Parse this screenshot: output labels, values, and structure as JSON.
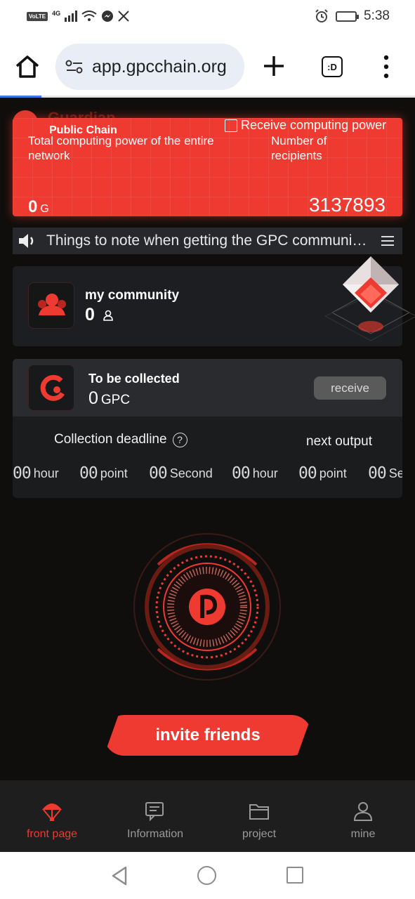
{
  "status_bar": {
    "time": "5:38",
    "volte": "VoLTE",
    "network": "4G"
  },
  "browser": {
    "url": "app.gpcchain.org",
    "tabs_label": ":D"
  },
  "page": {
    "logo_peek_text": "Guardian",
    "power_card": {
      "public_chain": "Public Chain",
      "receive_link": "Receive computing power",
      "total_label": "Total computing power of the entire network",
      "total_value": "0",
      "total_unit": "G",
      "recipients_label": "Number of recipients",
      "recipients_value": "3137893"
    },
    "notice": {
      "text": "Things to note when getting the GPC community computing power"
    },
    "community": {
      "title": "my community",
      "count": "0"
    },
    "collect": {
      "title": "To be collected",
      "value": "0",
      "unit": "GPC",
      "receive_label": "receive",
      "deadline_label": "Collection deadline",
      "next_label": "next output",
      "timers": [
        {
          "digits": "00",
          "unit": "hour"
        },
        {
          "digits": "00",
          "unit": "point"
        },
        {
          "digits": "00",
          "unit": "Second"
        },
        {
          "digits": "00",
          "unit": "hour"
        },
        {
          "digits": "00",
          "unit": "point"
        },
        {
          "digits": "00",
          "unit": "Second"
        }
      ]
    },
    "invite_label": "invite friends"
  },
  "bottom_nav": {
    "items": [
      {
        "label": "front page",
        "icon": "parachute-icon",
        "active": true
      },
      {
        "label": "Information",
        "icon": "chat-icon",
        "active": false
      },
      {
        "label": "project",
        "icon": "folder-icon",
        "active": false
      },
      {
        "label": "mine",
        "icon": "person-icon",
        "active": false
      }
    ]
  },
  "colors": {
    "accent": "#ee3a31",
    "background": "#100e0c",
    "card": "#1d1e21"
  }
}
